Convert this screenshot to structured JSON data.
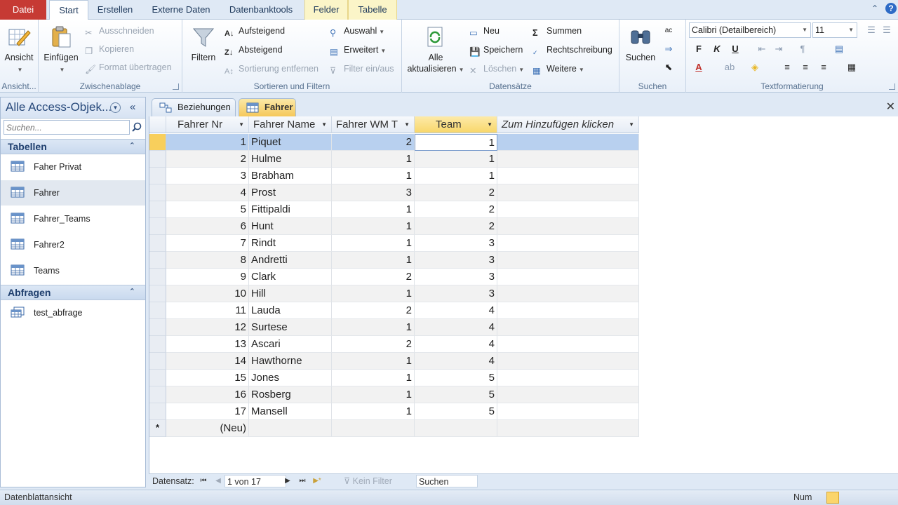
{
  "ribbon_tabs": [
    "Datei",
    "Start",
    "Erstellen",
    "Externe Daten",
    "Datenbanktools",
    "Felder",
    "Tabelle"
  ],
  "ribbon": {
    "views": {
      "label": "Ansicht",
      "group": "Ansicht..."
    },
    "clipboard": {
      "paste": "Einfügen",
      "cut": "Ausschneiden",
      "copy": "Kopieren",
      "format_painter": "Format übertragen",
      "group": "Zwischenablage"
    },
    "sort_filter": {
      "filter": "Filtern",
      "ascending": "Aufsteigend",
      "descending": "Absteigend",
      "remove_sort": "Sortierung entfernen",
      "selection": "Auswahl",
      "advanced": "Erweitert",
      "toggle_filter": "Filter ein/aus",
      "group": "Sortieren und Filtern"
    },
    "records": {
      "refresh_line1": "Alle",
      "refresh_line2": "aktualisieren",
      "new": "Neu",
      "save": "Speichern",
      "delete": "Löschen",
      "totals": "Summen",
      "spelling": "Rechtschreibung",
      "more": "Weitere",
      "group": "Datensätze"
    },
    "find": {
      "find": "Suchen",
      "group": "Suchen"
    },
    "text_formatting": {
      "font": "Calibri (Detailbereich)",
      "size": "11",
      "bold": "F",
      "italic": "K",
      "underline": "U",
      "group": "Textformatierung"
    }
  },
  "nav_pane": {
    "title": "Alle Access-Objek...",
    "search_placeholder": "Suchen...",
    "sections": [
      {
        "title": "Tabellen",
        "items": [
          "Faher Privat",
          "Fahrer",
          "Fahrer_Teams",
          "Fahrer2",
          "Teams"
        ]
      },
      {
        "title": "Abfragen",
        "items": [
          "test_abfrage"
        ]
      }
    ]
  },
  "doc_tabs": [
    "Beziehungen",
    "Fahrer"
  ],
  "table": {
    "columns": [
      "Fahrer Nr",
      "Fahrer Name",
      "Fahrer WM T",
      "Team",
      "Zum Hinzufügen klicken"
    ],
    "rows": [
      [
        1,
        "Piquet",
        2,
        1
      ],
      [
        2,
        "Hulme",
        1,
        1
      ],
      [
        3,
        "Brabham",
        1,
        1
      ],
      [
        4,
        "Prost",
        3,
        2
      ],
      [
        5,
        "Fittipaldi",
        1,
        2
      ],
      [
        6,
        "Hunt",
        1,
        2
      ],
      [
        7,
        "Rindt",
        1,
        3
      ],
      [
        8,
        "Andretti",
        1,
        3
      ],
      [
        9,
        "Clark",
        2,
        3
      ],
      [
        10,
        "Hill",
        1,
        3
      ],
      [
        11,
        "Lauda",
        2,
        4
      ],
      [
        12,
        "Surtese",
        1,
        4
      ],
      [
        13,
        "Ascari",
        2,
        4
      ],
      [
        14,
        "Hawthorne",
        1,
        4
      ],
      [
        15,
        "Jones",
        1,
        5
      ],
      [
        16,
        "Rosberg",
        1,
        5
      ],
      [
        17,
        "Mansell",
        1,
        5
      ]
    ],
    "new_row": "(Neu)"
  },
  "record_nav": {
    "label": "Datensatz:",
    "position": "1 von 17",
    "filter": "Kein Filter",
    "search": "Suchen"
  },
  "status": {
    "text": "Datenblattansicht",
    "num": "Num"
  }
}
